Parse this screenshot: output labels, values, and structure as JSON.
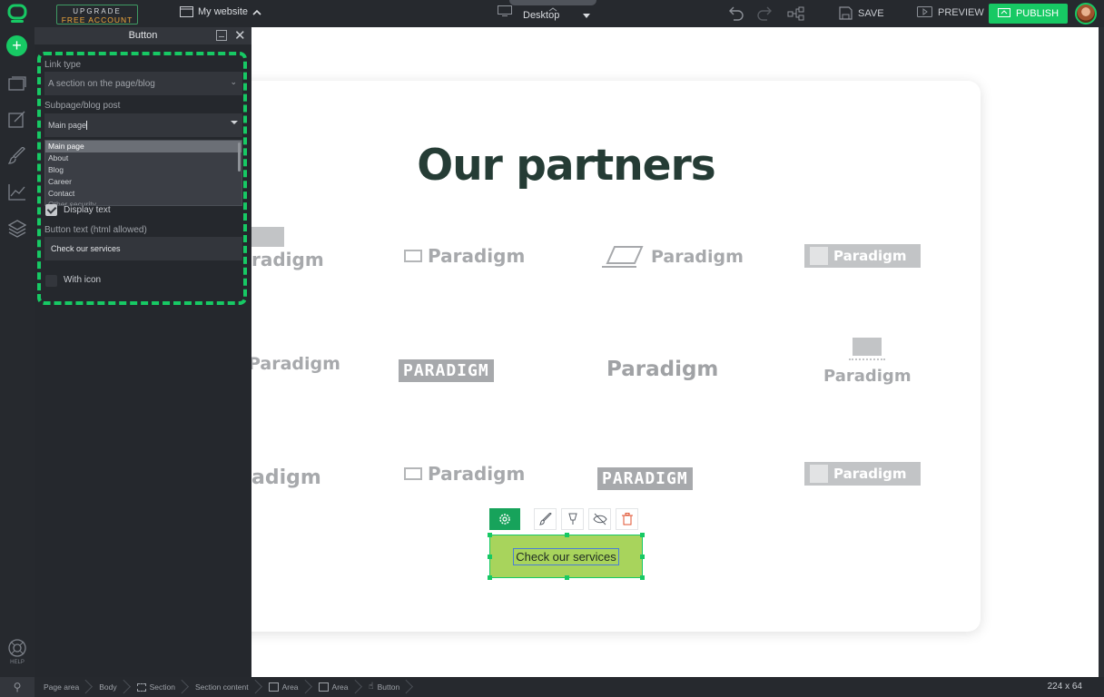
{
  "topbar": {
    "upgrade_line1": "UPGRADE",
    "upgrade_line2": "FREE ACCOUNT",
    "site_name": "My website",
    "device": "Desktop",
    "save": "SAVE",
    "preview": "PREVIEW",
    "publish": "PUBLISH"
  },
  "rail": {
    "help": "HELP"
  },
  "panel": {
    "title": "Button",
    "link_type_label": "Link type",
    "link_type_value": "A section on the page/blog",
    "subpage_label": "Subpage/blog post",
    "subpage_value": "Main page",
    "options": [
      "Main page",
      "About",
      "Blog",
      "Career",
      "Contact",
      "Other security"
    ],
    "display_text": "Display text",
    "button_text_label": "Button text (html allowed)",
    "button_text_value": "Check our services",
    "with_icon": "With icon"
  },
  "canvas": {
    "heading": "Our partners",
    "partner_logo_text": "Paradigm",
    "partner_logo_caps": "PARADIGM",
    "partner_logo_partial": "radigm",
    "partner_logo_partial2": "adigm",
    "cta_label": "Check our services"
  },
  "bottombar": {
    "crumbs": [
      "Page area",
      "Body",
      "Section",
      "Section content",
      "Area",
      "Area",
      "Button"
    ],
    "dimensions": "224 x 64"
  },
  "colors": {
    "accent": "#17c964",
    "heading": "#253c35",
    "cta_fill": "#a8d45c",
    "delete": "#e0522f"
  }
}
